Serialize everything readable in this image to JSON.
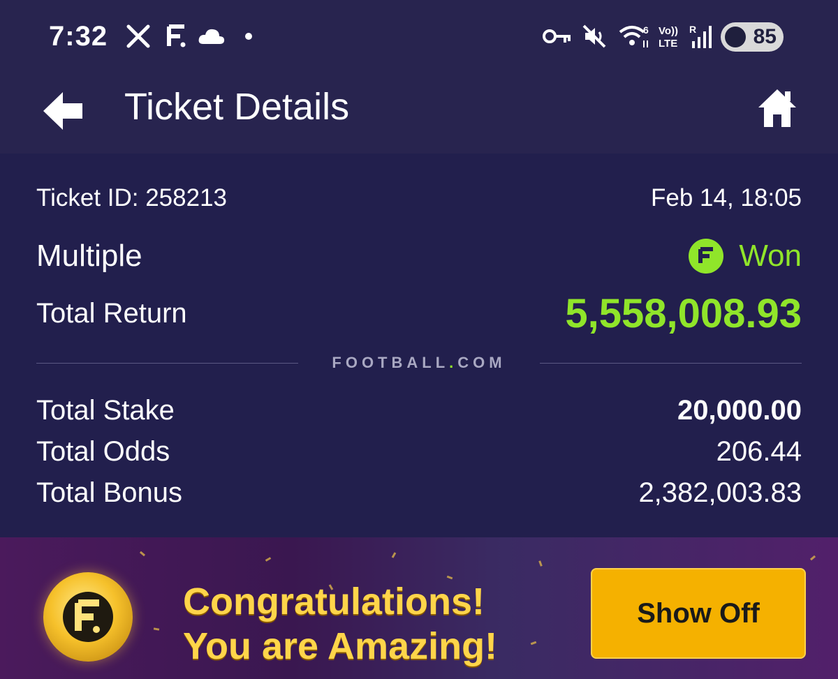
{
  "status_bar": {
    "time": "7:32",
    "icons": [
      "x-icon",
      "f-icon",
      "cloud-icon",
      "dot-icon",
      "key-icon",
      "mute-icon",
      "wifi-icon",
      "volte-icon",
      "signal-icon"
    ],
    "battery": "85"
  },
  "header": {
    "title": "Ticket Details"
  },
  "ticket": {
    "id_label": "Ticket ID: 258213",
    "date": "Feb 14, 18:05",
    "type": "Multiple",
    "status": "Won",
    "total_return_label": "Total Return",
    "total_return_value": "5,558,008.93",
    "brand": "FOOTBALL",
    "brand_dot": ".",
    "brand_suffix": "COM",
    "stake_label": "Total Stake",
    "stake_value": "20,000.00",
    "odds_label": "Total Odds",
    "odds_value": "206.44",
    "bonus_label": "Total Bonus",
    "bonus_value": "2,382,003.83"
  },
  "promo": {
    "line1": "Congratulations!",
    "line2": "You are Amazing!",
    "button": "Show Off"
  },
  "colors": {
    "background": "#221f4d",
    "header": "#28244f",
    "accent_green": "#90e52a",
    "button_gold": "#f5b100"
  }
}
